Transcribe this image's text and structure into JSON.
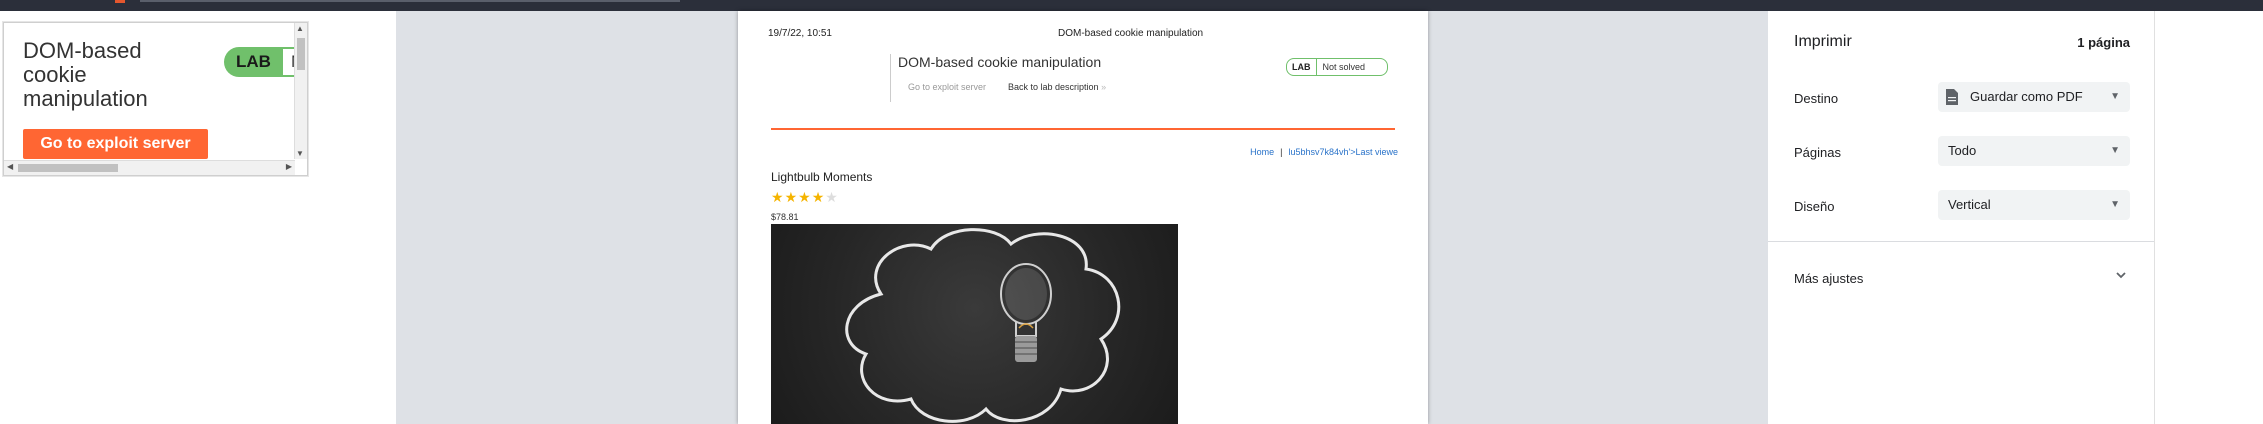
{
  "mini_lab": {
    "title": "DOM-based cookie manipulation",
    "lab_badge": "LAB",
    "status_partial": "N",
    "exploit_button": "Go to exploit server"
  },
  "print_page": {
    "date": "19/7/22, 10:51",
    "doc_title": "DOM-based cookie manipulation",
    "lab_title": "DOM-based cookie manipulation",
    "exploit_link": "Go to exploit server",
    "back_link": "Back to lab description",
    "lab_badge": "LAB",
    "lab_status": "Not solved",
    "nav_home": "Home",
    "nav_sep": "|",
    "nav_last_viewed": "lu5bhsv7k84vh'>Last viewe",
    "product_name": "Lightbulb Moments",
    "rating": 4,
    "rating_max": 5,
    "price": "$78.81"
  },
  "settings": {
    "title": "Imprimir",
    "page_count": "1 página",
    "destination_label": "Destino",
    "destination_value": "Guardar como PDF",
    "pages_label": "Páginas",
    "pages_value": "Todo",
    "layout_label": "Diseño",
    "layout_value": "Vertical",
    "more_settings": "Más ajustes"
  },
  "colors": {
    "accent_orange": "#ff6633",
    "lab_green": "#70c06b",
    "link_blue": "#2a73c9",
    "star_gold": "#f5b400"
  }
}
